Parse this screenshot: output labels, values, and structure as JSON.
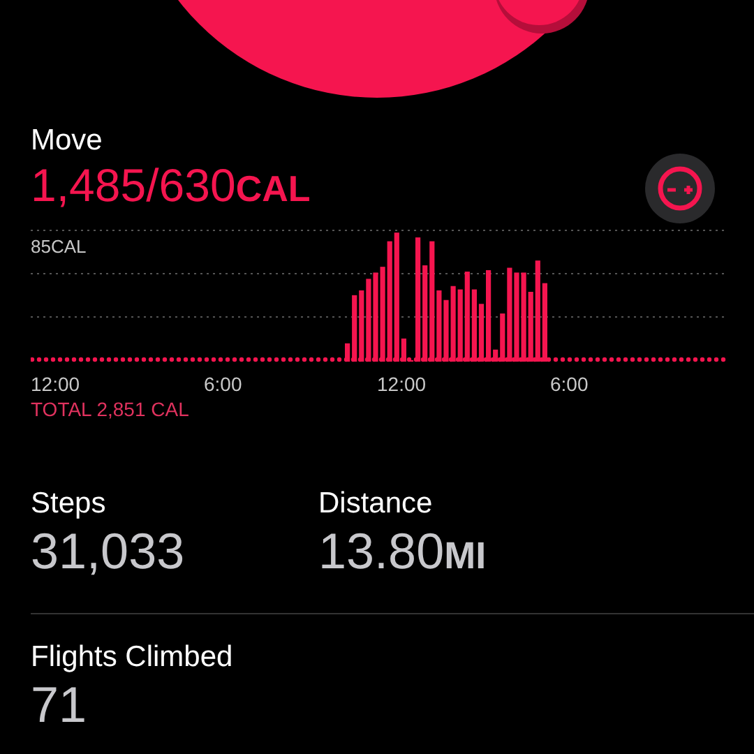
{
  "move": {
    "label": "Move",
    "value": "1,485/630",
    "unit": "CAL"
  },
  "chart": {
    "max_label": "85CAL",
    "x_labels": [
      "12:00",
      "6:00",
      "12:00",
      "6:00"
    ],
    "total": "TOTAL 2,851 CAL"
  },
  "stats": [
    {
      "label": "Steps",
      "value": "31,033"
    },
    {
      "label": "Distance",
      "value": "13.80",
      "unit": "MI"
    },
    {
      "label": "Flights Climbed",
      "value": "71"
    }
  ]
}
